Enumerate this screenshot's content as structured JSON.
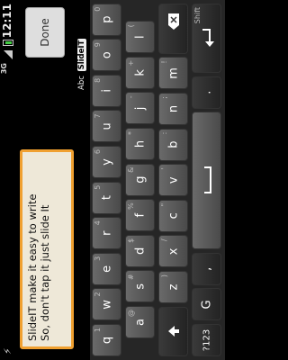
{
  "status_bar": {
    "time": "12:11",
    "network": "3G",
    "usb_icon": "usb-icon",
    "signal_icon": "signal-icon",
    "battery_icon": "battery-icon"
  },
  "editor": {
    "line1": "SlideIT make it easy to write",
    "line2": "So, don't tap it just slide It"
  },
  "done_label": "Done",
  "suggestion_bar": {
    "prefix": "Abc",
    "logo": "SlideIT"
  },
  "keyboard": {
    "rows": [
      [
        {
          "label": "q",
          "hint": "1"
        },
        {
          "label": "w",
          "hint": "2"
        },
        {
          "label": "e",
          "hint": "3"
        },
        {
          "label": "r",
          "hint": "4"
        },
        {
          "label": "t",
          "hint": "5"
        },
        {
          "label": "y",
          "hint": "6"
        },
        {
          "label": "u",
          "hint": "7"
        },
        {
          "label": "i",
          "hint": "8"
        },
        {
          "label": "o",
          "hint": "9"
        },
        {
          "label": "p",
          "hint": "0"
        }
      ],
      [
        {
          "label": "a",
          "hint": "@"
        },
        {
          "label": "s",
          "hint": "#"
        },
        {
          "label": "d",
          "hint": "$"
        },
        {
          "label": "f",
          "hint": "%"
        },
        {
          "label": "g",
          "hint": "&"
        },
        {
          "label": "h",
          "hint": "*"
        },
        {
          "label": "j",
          "hint": "-"
        },
        {
          "label": "k",
          "hint": "+"
        },
        {
          "label": "l",
          "hint": "("
        }
      ],
      [
        {
          "label": "z",
          "hint": ")"
        },
        {
          "label": "x",
          "hint": "/"
        },
        {
          "label": "c",
          "hint": "\""
        },
        {
          "label": "v",
          "hint": "'"
        },
        {
          "label": "b",
          "hint": ":"
        },
        {
          "label": "n",
          "hint": ";"
        },
        {
          "label": "m",
          "hint": "!"
        }
      ]
    ],
    "special": {
      "sym_label": "?123",
      "shift_icon": "shift-icon",
      "delete_icon": "delete-icon",
      "settings_label": "G",
      "comma_label": ",",
      "space_icon": "space-icon",
      "period_label": ".",
      "enter_icon": "enter-icon",
      "enter_hint": "Shift"
    }
  }
}
